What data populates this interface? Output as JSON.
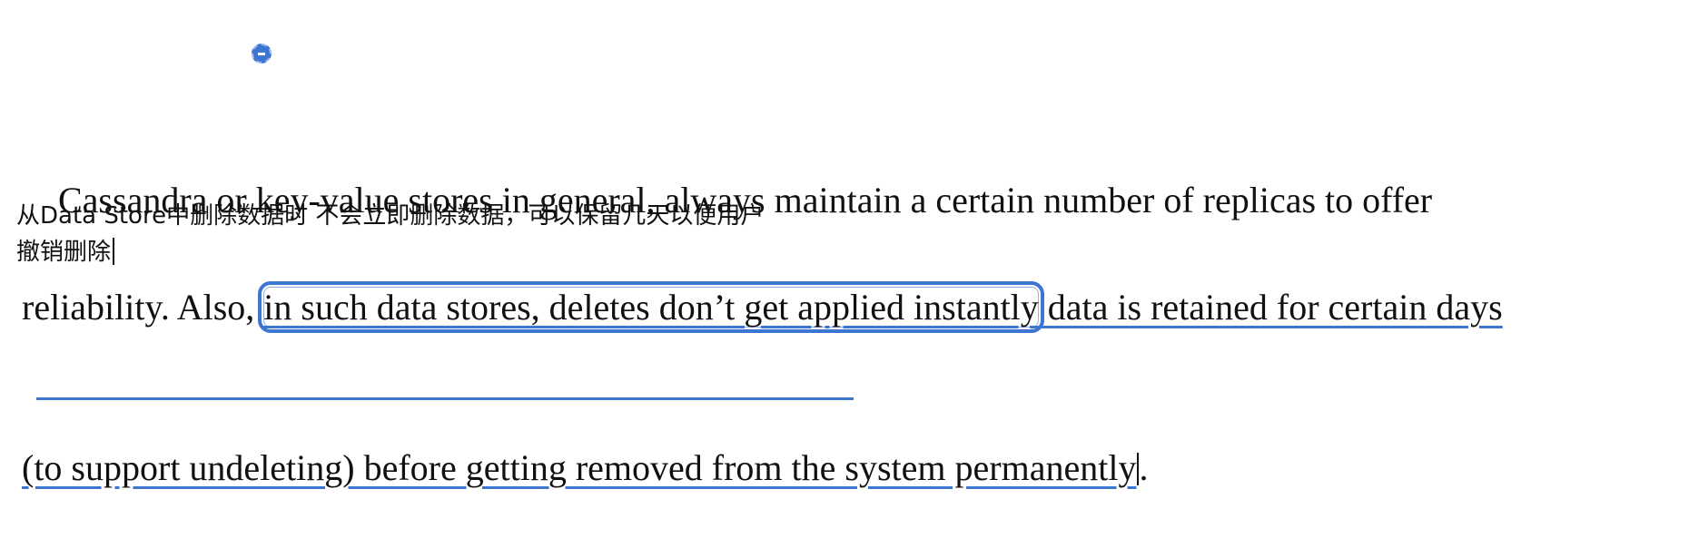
{
  "paragraph": {
    "line1": "Cassandra or key-value stores in general, always maintain a certain number of replicas to offer",
    "line2_prefix": "reliability. Also, ",
    "line2_highlight": "in such data stores, deletes don’t get applied instantly",
    "line2_suffix": " data is retained for certain days",
    "line3_underlined": "(to support undeleting) before getting removed from the system permanently",
    "line3_end": "."
  },
  "note": {
    "line1": "从Data Store中删除数据时 不会立即删除数据，可以保留几天以便用户",
    "line2": "撤销删除"
  },
  "colors": {
    "accent": "#3d76d1",
    "text": "#111111",
    "background": "#ffffff"
  }
}
